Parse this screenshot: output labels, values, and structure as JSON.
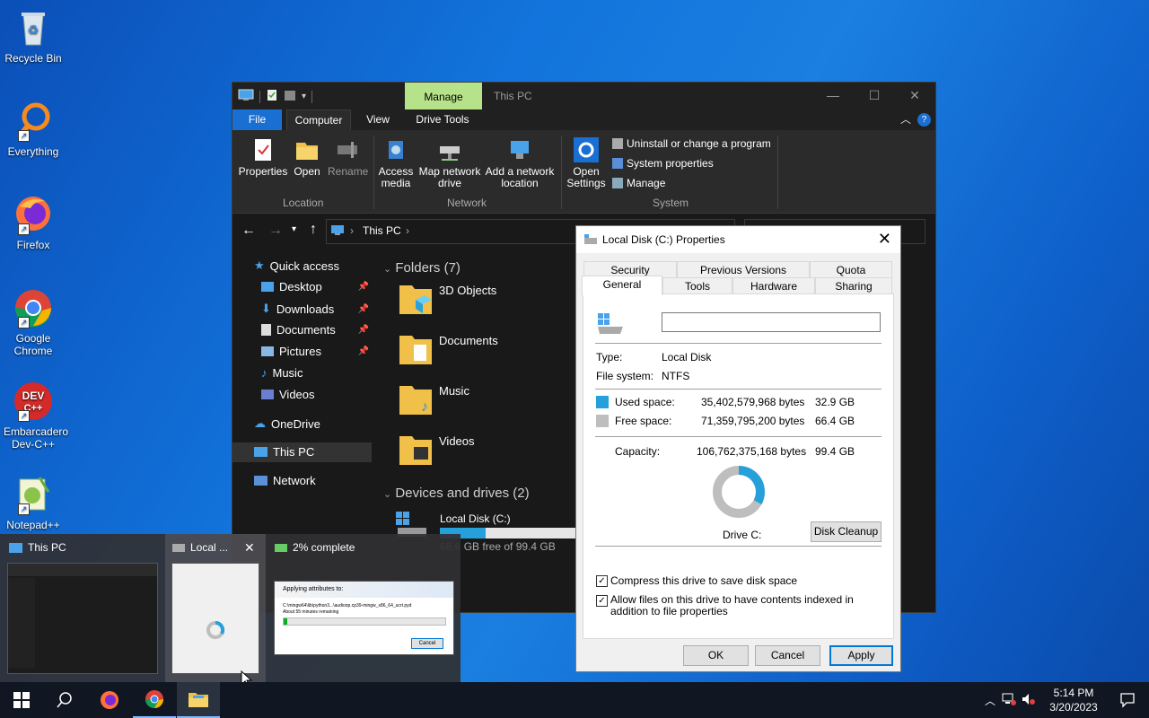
{
  "desktop": {
    "icons": [
      {
        "label": "Recycle Bin"
      },
      {
        "label": "Everything"
      },
      {
        "label": "Firefox"
      },
      {
        "label": "Google Chrome"
      },
      {
        "label": "Embarcadero Dev-C++"
      },
      {
        "label": "Notepad++"
      }
    ]
  },
  "explorer": {
    "context_tab": "Manage",
    "title": "This PC",
    "tabs": [
      "File",
      "Computer",
      "View",
      "Drive Tools"
    ],
    "ribbon": {
      "location": {
        "group": "Location",
        "buttons": [
          "Properties",
          "Open",
          "Rename"
        ]
      },
      "network": {
        "group": "Network",
        "buttons": [
          "Access media",
          "Map network drive",
          "Add a network location"
        ]
      },
      "system": {
        "group": "System",
        "open_settings": "Open Settings",
        "items": [
          "Uninstall or change a program",
          "System properties",
          "Manage"
        ]
      }
    },
    "address": {
      "crumb": "This PC"
    },
    "nav": {
      "quick_access": "Quick access",
      "items": [
        "Desktop",
        "Downloads",
        "Documents",
        "Pictures",
        "Music",
        "Videos"
      ],
      "onedrive": "OneDrive",
      "this_pc": "This PC",
      "network": "Network"
    },
    "folders_header": "Folders (7)",
    "folders": [
      "3D Objects",
      "Documents",
      "Music",
      "Videos"
    ],
    "devices_header": "Devices and drives (2)",
    "drive": {
      "name": "Local Disk (C:)",
      "free_text": "66.6 GB free of 99.4 GB",
      "used_fraction": 0.33
    }
  },
  "properties": {
    "title": "Local Disk (C:) Properties",
    "tabs_row1": [
      "Security",
      "Previous Versions",
      "Quota"
    ],
    "tabs_row2": [
      "General",
      "Tools",
      "Hardware",
      "Sharing"
    ],
    "label_value": "",
    "type_label": "Type:",
    "type_value": "Local Disk",
    "fs_label": "File system:",
    "fs_value": "NTFS",
    "used_label": "Used space:",
    "used_bytes": "35,402,579,968 bytes",
    "used_gb": "32.9 GB",
    "free_label": "Free space:",
    "free_bytes": "71,359,795,200 bytes",
    "free_gb": "66.4 GB",
    "cap_label": "Capacity:",
    "cap_bytes": "106,762,375,168 bytes",
    "cap_gb": "99.4 GB",
    "drive_label": "Drive C:",
    "cleanup": "Disk Cleanup",
    "compress": "Compress this drive to save disk space",
    "index": "Allow files on this drive to have contents indexed in addition to file properties",
    "ok": "OK",
    "cancel": "Cancel",
    "apply": "Apply",
    "used_color": "#26a0da",
    "free_color": "#bebebe"
  },
  "preview": {
    "items": [
      "This PC",
      "Local ...",
      "2% complete"
    ],
    "applying": "Applying attributes to:",
    "path": "C:\\mingw64\\lib\\python3...\\audioop.cp39-mingw_x86_64_ucrt.pyd",
    "remaining": "About 55 minutes remaining",
    "cancel": "Cancel",
    "progress": 0.02
  },
  "taskbar": {
    "time": "5:14 PM",
    "date": "3/20/2023"
  }
}
